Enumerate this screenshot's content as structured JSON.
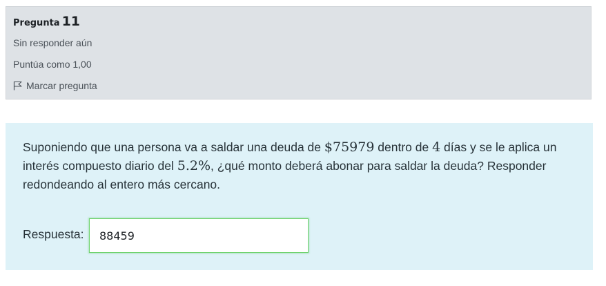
{
  "question_info": {
    "label": "Pregunta",
    "number": "11",
    "state": "Sin responder aún",
    "grade": "Puntúa como 1,00",
    "flag_label": "Marcar pregunta"
  },
  "question": {
    "text_1": "Suponiendo que una persona va a saldar una deuda de ",
    "amount": "$75979",
    "text_2": " dentro de ",
    "days": "4",
    "text_3": " días y se le aplica un interés compuesto diario del ",
    "rate": "5.2%",
    "text_4": ", ¿qué monto deberá abonar para saldar la deuda? Responder redondeando al entero más cercano."
  },
  "answer": {
    "label": "Respuesta:",
    "value": "88459"
  },
  "icons": {
    "flag": "flag-outline-icon"
  },
  "colors": {
    "info_background": "#dee2e6",
    "formulation_background": "#def2f8",
    "input_border": "#6fd36f"
  }
}
